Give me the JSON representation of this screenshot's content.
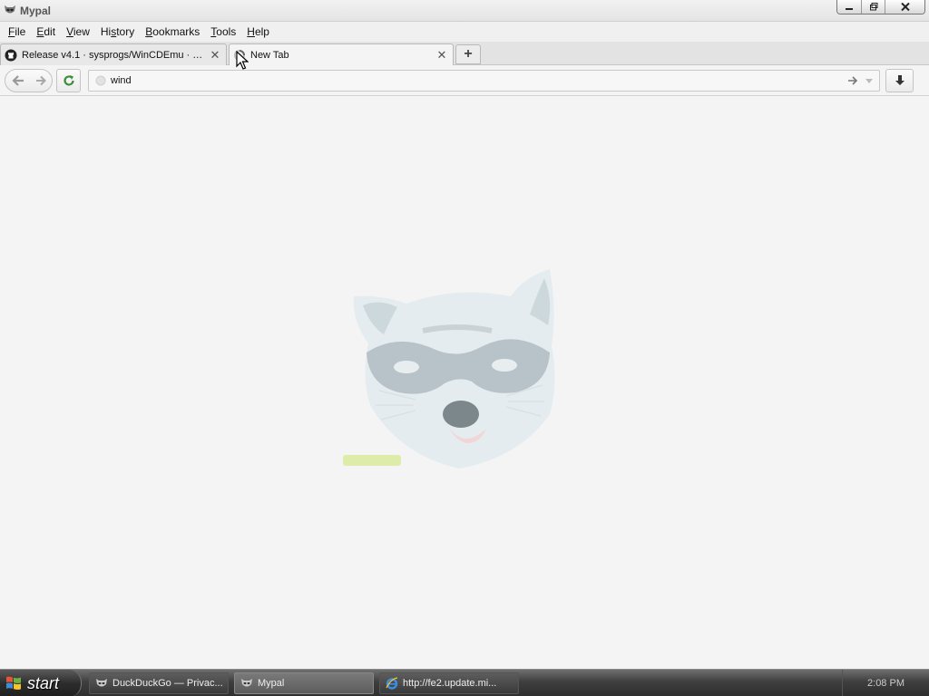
{
  "window": {
    "title": "Mypal"
  },
  "menubar": {
    "items": [
      {
        "pre": "",
        "u": "F",
        "post": "ile"
      },
      {
        "pre": "",
        "u": "E",
        "post": "dit"
      },
      {
        "pre": "",
        "u": "V",
        "post": "iew"
      },
      {
        "pre": "Hi",
        "u": "s",
        "post": "tory"
      },
      {
        "pre": "",
        "u": "B",
        "post": "ookmarks"
      },
      {
        "pre": "",
        "u": "T",
        "post": "ools"
      },
      {
        "pre": "",
        "u": "H",
        "post": "elp"
      }
    ]
  },
  "tabs": [
    {
      "label": "Release v4.1 · sysprogs/WinCDEmu · GitH...",
      "icon": "github-icon",
      "active": false
    },
    {
      "label": "New Tab",
      "icon": "loading-icon",
      "active": true
    }
  ],
  "navbar": {
    "url_value": "wind"
  },
  "taskbar": {
    "start_label": "start",
    "tasks": [
      {
        "label": "DuckDuckGo — Privac...",
        "icon": "mypal-icon",
        "active": false
      },
      {
        "label": "Mypal",
        "icon": "mypal-icon",
        "active": true
      },
      {
        "label": "http://fe2.update.mi...",
        "icon": "internet-explorer-icon",
        "active": false
      }
    ],
    "clock": "2:08 PM"
  },
  "colors": {
    "accent": "#3a8d3a",
    "logo_text": "#c8e07a",
    "taskbar": "#3f3f3f"
  }
}
